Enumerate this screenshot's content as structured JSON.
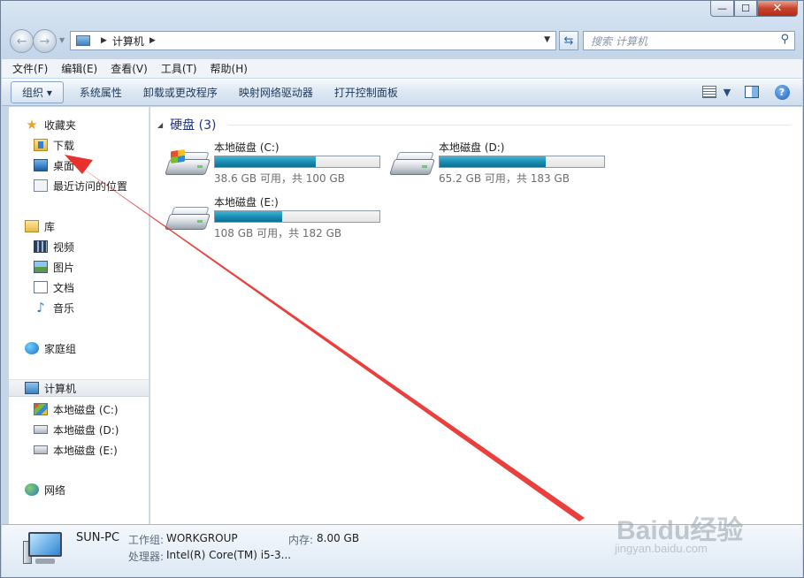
{
  "window": {
    "min_label": "—",
    "max_label": "☐",
    "close_label": "✕"
  },
  "nav": {
    "back_icon": "←",
    "forward_icon": "→",
    "breadcrumb": "计算机",
    "search_placeholder": "搜索 计算机"
  },
  "menubar": {
    "items": [
      "文件(F)",
      "编辑(E)",
      "查看(V)",
      "工具(T)",
      "帮助(H)"
    ]
  },
  "toolbar": {
    "organize_label": "组织 ▾",
    "items": [
      "系统属性",
      "卸载或更改程序",
      "映射网络驱动器",
      "打开控制面板"
    ],
    "view_icon": "view-icon",
    "pane_icon": "preview-pane-icon",
    "help_icon": "?"
  },
  "sidebar": {
    "favorites": "收藏夹",
    "downloads": "下载",
    "desktop": "桌面",
    "recent": "最近访问的位置",
    "libraries": "库",
    "videos": "视频",
    "pictures": "图片",
    "documents": "文档",
    "music": "音乐",
    "homegroup": "家庭组",
    "computer": "计算机",
    "drive_c": "本地磁盘 (C:)",
    "drive_d": "本地磁盘 (D:)",
    "drive_e": "本地磁盘 (E:)",
    "network": "网络"
  },
  "content": {
    "group_title": "硬盘 (3)",
    "drives": [
      {
        "name": "本地磁盘 (C:)",
        "free_text": "38.6 GB 可用，共 100 GB",
        "used_fraction": 0.614
      },
      {
        "name": "本地磁盘 (D:)",
        "free_text": "65.2 GB 可用，共 183 GB",
        "used_fraction": 0.644
      },
      {
        "name": "本地磁盘 (E:)",
        "free_text": "108 GB 可用，共 182 GB",
        "used_fraction": 0.407
      }
    ]
  },
  "details": {
    "pc_name": "SUN-PC",
    "workgroup_label": "工作组:",
    "workgroup_value": "WORKGROUP",
    "memory_label": "内存:",
    "memory_value": "8.00 GB",
    "cpu_label": "处理器:",
    "cpu_value": "Intel(R) Core(TM) i5-3..."
  },
  "watermark": {
    "brand": "Baidu经验",
    "url": "jingyan.baidu.com"
  },
  "colors": {
    "accent": "#1e3287",
    "bar_fill": "#1a8fb3",
    "annotation": "#e8302c"
  }
}
